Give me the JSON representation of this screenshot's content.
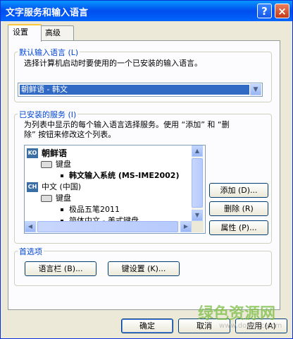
{
  "window": {
    "title": "文字服务和输入语言",
    "help_glyph": "?",
    "close_glyph": "×"
  },
  "tabs": [
    {
      "label": "设置",
      "active": true
    },
    {
      "label": "高级",
      "active": false
    }
  ],
  "default_language": {
    "legend": "默认输入语言 (L)",
    "description": "选择计算机启动时要使用的一个已安装的输入语言。",
    "selected": "朝鲜语 - 韩文"
  },
  "installed_services": {
    "legend": "已安装的服务 (I)",
    "description_line1": "为列表中显示的每个输入语言选择服务。使用 “添加” 和 “删",
    "description_line2": "除” 按钮来修改这个列表。",
    "tree": {
      "lang1": {
        "code": "KO",
        "name": "朝鲜语"
      },
      "lang1_keyboard": "键盘",
      "lang1_ime": "韩文输入系统 (MS-IME2002)",
      "lang2": {
        "code": "CH",
        "name": "中文 (中国)"
      },
      "lang2_keyboard": "键盘",
      "lang2_item1": "极品五笔2011",
      "lang2_item2": "简体中文 - 美式键盘"
    },
    "buttons": {
      "add": "添加 (D)...",
      "remove": "删除 (R)",
      "properties": "属性 (P)..."
    }
  },
  "preferences": {
    "legend": "首选项",
    "language_bar": "语言栏 (B)...",
    "key_settings": "键设置 (K)..."
  },
  "footer": {
    "ok": "确定",
    "cancel": "取消",
    "apply": "应用 (A)"
  },
  "watermark": {
    "text": "绿色资源网",
    "url": "www.downcc.com"
  },
  "colors": {
    "titlebar": "#0054e3",
    "legend_text": "#0046d5",
    "selection": "#316ac5"
  },
  "icons": {
    "lang_indicator": "lang-code-icon",
    "keyboard": "keyboard-icon",
    "help": "help-icon",
    "close": "close-icon"
  }
}
